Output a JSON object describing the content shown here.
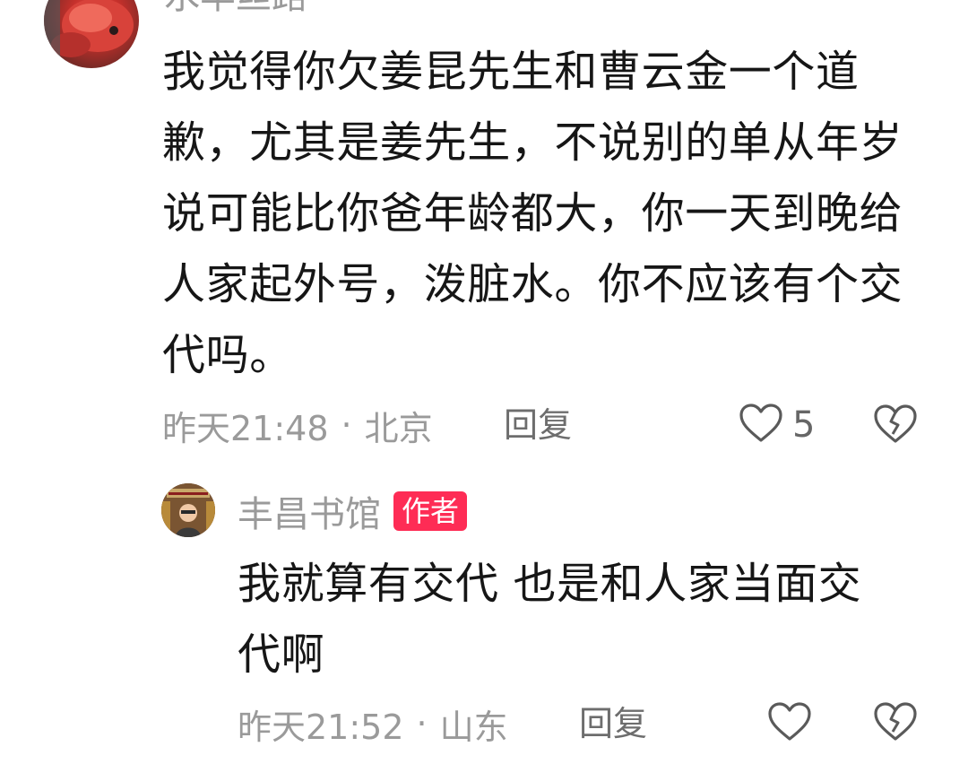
{
  "comment": {
    "username": "水羊丝路",
    "text": "我觉得你欠姜昆先生和曹云金一个道歉，尤其是姜先生，不说别的单从年岁说可能比你爸年龄都大，你一天到晚给人家起外号，泼脏水。你不应该有个交代吗。",
    "time": "昨天21:48",
    "separator": "·",
    "location": "北京",
    "reply_label": "回复",
    "like_count": "5",
    "icons": {
      "like": "heart-outline-icon",
      "dislike": "broken-heart-icon"
    }
  },
  "reply": {
    "username": "丰昌书馆",
    "badge": "作者",
    "text": "我就算有交代 也是和人家当面交代啊",
    "time": "昨天21:52",
    "separator": "·",
    "location": "山东",
    "reply_label": "回复",
    "icons": {
      "like": "heart-outline-icon",
      "dislike": "broken-heart-icon"
    }
  },
  "colors": {
    "text": "#161616",
    "muted": "#9a9a9a",
    "badge": "#fe2c55"
  }
}
